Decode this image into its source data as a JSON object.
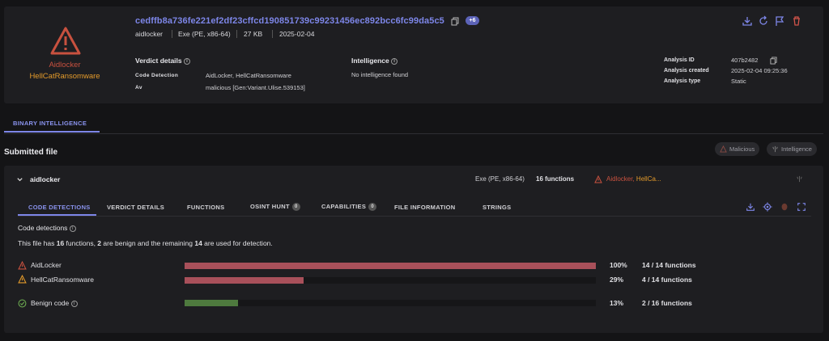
{
  "header": {
    "families": [
      "Aidlocker",
      "HellCatRansomware"
    ],
    "hash": "cedffb8a736fe221ef2df23cffcd190851739c99231456ec892bcc6fc99da5c5",
    "more_badge": "+6",
    "meta": {
      "name": "aidlocker",
      "type": "Exe (PE, x86-64)",
      "size": "27 KB",
      "date": "2025-02-04"
    }
  },
  "verdict": {
    "title": "Verdict details",
    "rows": [
      {
        "key": "Code Detection",
        "value": "AidLocker, HellCatRansomware"
      },
      {
        "key": "Av",
        "value": "malicious [Gen:Variant.Ulise.539153]"
      }
    ]
  },
  "intelligence": {
    "title": "Intelligence",
    "value": "No intelligence found"
  },
  "analysis": {
    "rows": [
      {
        "key": "Analysis ID",
        "value": "407b2482"
      },
      {
        "key": "Analysis created",
        "value": "2025-02-04 09:25:36"
      },
      {
        "key": "Analysis type",
        "value": "Static"
      }
    ]
  },
  "main_tabs": {
    "active": "BINARY INTELLIGENCE"
  },
  "submitted": {
    "title": "Submitted file",
    "chips": [
      "Malicious",
      "Intelligence"
    ]
  },
  "file": {
    "name": "aidlocker",
    "type": "Exe (PE, x86-64)",
    "functions": "16 functions",
    "family_red": "Aidlocker,",
    "family_orange": "HellCa..."
  },
  "sub_tabs": [
    {
      "label": "CODE DETECTIONS",
      "badge": ""
    },
    {
      "label": "VERDICT DETAILS",
      "badge": ""
    },
    {
      "label": "FUNCTIONS",
      "badge": ""
    },
    {
      "label": "OSINT HUNT",
      "badge": "0"
    },
    {
      "label": "CAPABILITIES",
      "badge": "0"
    },
    {
      "label": "FILE INFORMATION",
      "badge": ""
    },
    {
      "label": "STRINGS",
      "badge": ""
    }
  ],
  "code_detections": {
    "title": "Code detections",
    "summary_pre": "This file has ",
    "total": "16",
    "summary_mid1": " functions, ",
    "benign": "2",
    "summary_mid2": " are benign and the remaining ",
    "detected": "14",
    "summary_post": " are used for detection.",
    "rows": [
      {
        "label": "AidLocker",
        "percent": "100%",
        "fraction": 1.0,
        "count": "14 / 14 functions",
        "color": "#a8505a"
      },
      {
        "label": "HellCatRansomware",
        "percent": "29%",
        "fraction": 0.29,
        "count": "4 / 14 functions",
        "color": "#a8505a"
      },
      {
        "label": "Benign code",
        "percent": "13%",
        "fraction": 0.13,
        "count": "2 / 16 functions",
        "color": "#4e7a3e"
      }
    ]
  },
  "colors": {
    "accent": "#7d86e8",
    "malicious": "#c8513f",
    "warning": "#e39a2b",
    "benign": "#4e7a3e"
  }
}
